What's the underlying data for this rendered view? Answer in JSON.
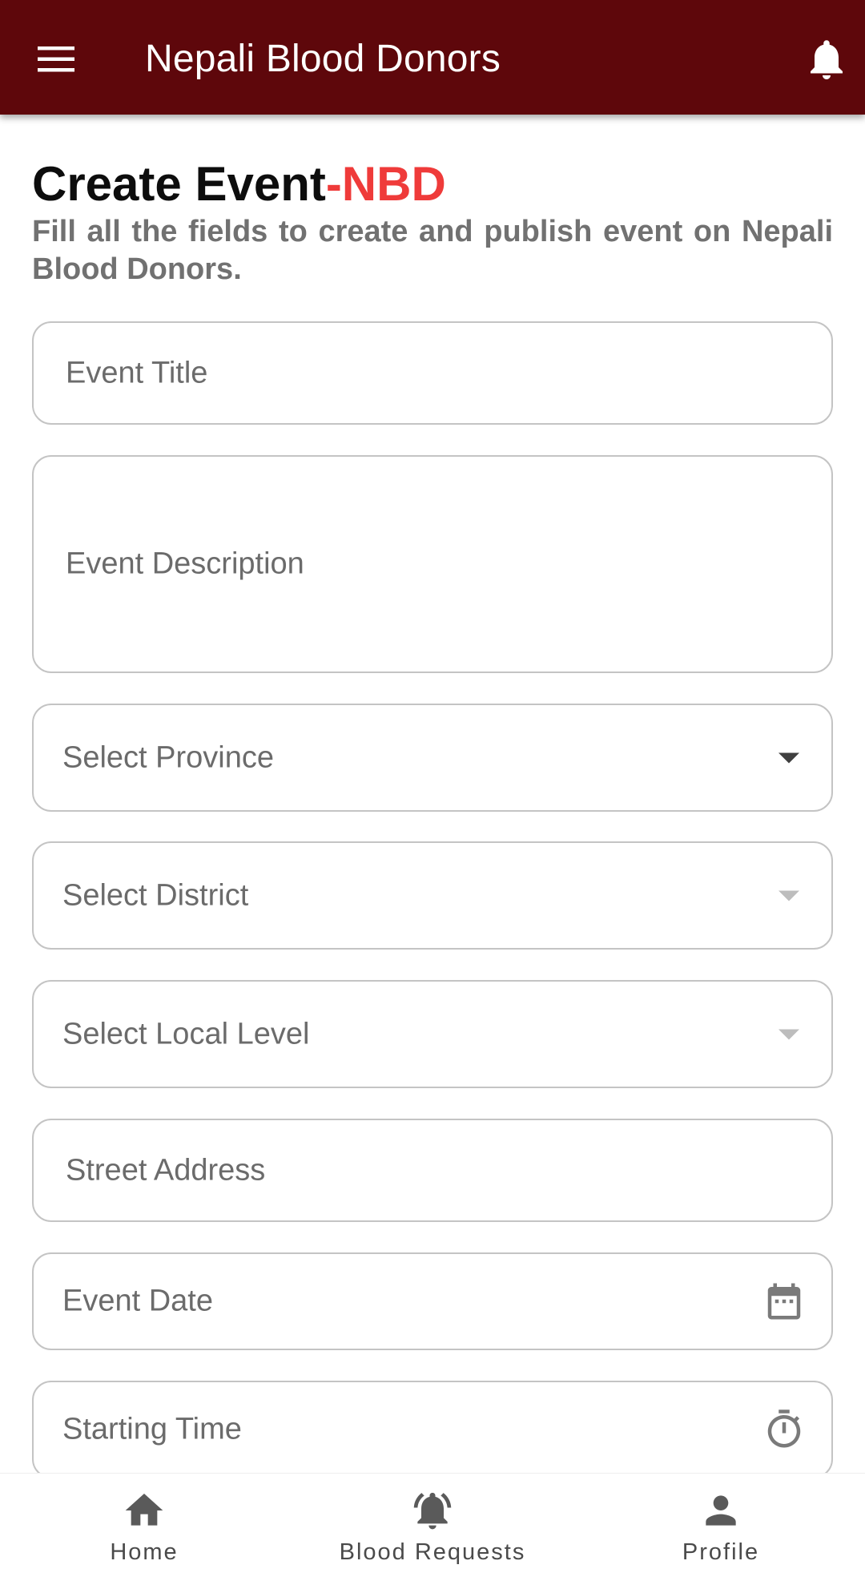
{
  "appbar": {
    "title": "Nepali Blood Donors",
    "menu_icon": "hamburger-menu-icon",
    "notification_icon": "bell-icon",
    "background_color": "#5e070b"
  },
  "heading": {
    "title": "Create Event",
    "title_accent": "-NBD",
    "accent_color": "#ef3b3a",
    "subtitle": "Fill all the fields to create and publish event on Nepali Blood Donors."
  },
  "form": {
    "event_title": {
      "placeholder": "Event Title",
      "value": ""
    },
    "event_description": {
      "placeholder": "Event Description",
      "value": ""
    },
    "province": {
      "placeholder": "Select Province",
      "value": "",
      "icon": "dropdown-arrow-icon"
    },
    "district": {
      "placeholder": "Select District",
      "value": "",
      "icon": "dropdown-arrow-icon"
    },
    "local_level": {
      "placeholder": "Select Local Level",
      "value": "",
      "icon": "dropdown-arrow-icon"
    },
    "street_address": {
      "placeholder": "Street Address",
      "value": ""
    },
    "event_date": {
      "placeholder": "Event Date",
      "value": "",
      "icon": "calendar-icon"
    },
    "starting_time": {
      "placeholder": "Starting Time",
      "value": "",
      "icon": "timer-icon"
    }
  },
  "bottom_nav": {
    "items": [
      {
        "label": "Home",
        "icon": "home-icon"
      },
      {
        "label": "Blood Requests",
        "icon": "notification-bell-icon"
      },
      {
        "label": "Profile",
        "icon": "person-icon"
      }
    ]
  }
}
